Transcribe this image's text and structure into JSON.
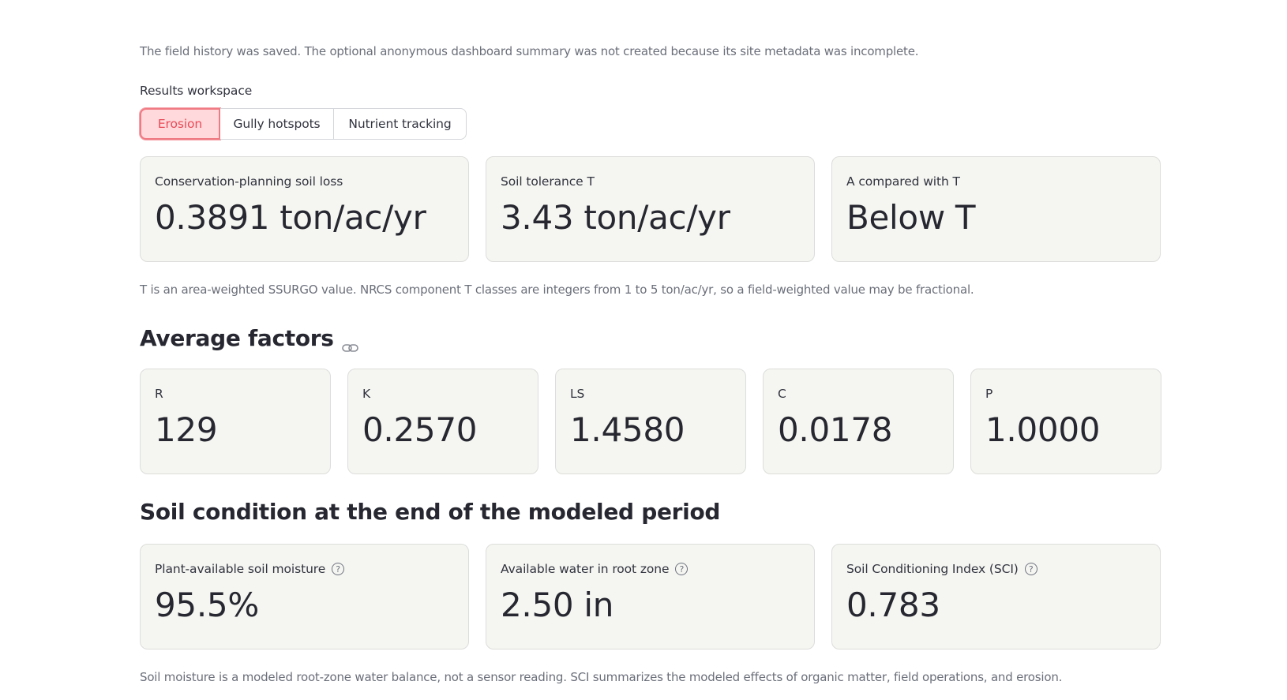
{
  "notice": "The field history was saved. The optional anonymous dashboard summary was not created because its site metadata was incomplete.",
  "workspace": {
    "label": "Results workspace",
    "tabs": [
      {
        "label": "Erosion",
        "active": true
      },
      {
        "label": "Gully hotspots",
        "active": false
      },
      {
        "label": "Nutrient tracking",
        "active": false
      }
    ]
  },
  "summary": {
    "cards": [
      {
        "label": "Conservation-planning soil loss",
        "value": "0.3891 ton/ac/yr"
      },
      {
        "label": "Soil tolerance T",
        "value": "3.43 ton/ac/yr"
      },
      {
        "label": "A compared with T",
        "value": "Below T"
      }
    ],
    "note": "T is an area-weighted SSURGO value. NRCS component T classes are integers from 1 to 5 ton/ac/yr, so a field-weighted value may be fractional."
  },
  "factors": {
    "title": "Average factors",
    "items": [
      {
        "label": "R",
        "value": "129"
      },
      {
        "label": "K",
        "value": "0.2570"
      },
      {
        "label": "LS",
        "value": "1.4580"
      },
      {
        "label": "C",
        "value": "0.0178"
      },
      {
        "label": "P",
        "value": "1.0000"
      }
    ]
  },
  "soil": {
    "title": "Soil condition at the end of the modeled period",
    "cards": [
      {
        "label": "Plant-available soil moisture",
        "value": "95.5%"
      },
      {
        "label": "Available water in root zone",
        "value": "2.50 in"
      },
      {
        "label": "Soil Conditioning Index (SCI)",
        "value": "0.783"
      }
    ],
    "note": "Soil moisture is a modeled root-zone water balance, not a sensor reading. SCI summarizes the modeled effects of organic matter, field operations, and erosion."
  },
  "icons": {
    "link": "link-icon",
    "help": "help-circle-icon"
  },
  "colors": {
    "active_tab_bg": "#ffd9dc",
    "active_tab_text": "#e84b57",
    "card_bg": "#f5f6f1"
  }
}
